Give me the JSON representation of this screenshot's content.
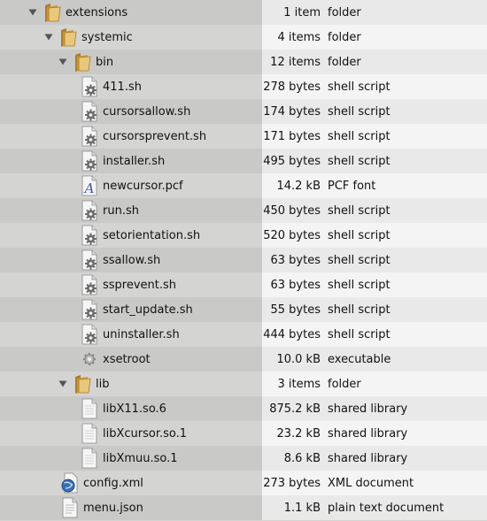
{
  "rows": [
    {
      "name": "extensions",
      "size": "1 item",
      "type": "folder",
      "depth": 0,
      "kind": "folder",
      "expanded": true
    },
    {
      "name": "systemic",
      "size": "4 items",
      "type": "folder",
      "depth": 1,
      "kind": "folder",
      "expanded": true
    },
    {
      "name": "bin",
      "size": "12 items",
      "type": "folder",
      "depth": 2,
      "kind": "folder",
      "expanded": true
    },
    {
      "name": "411.sh",
      "size": "278 bytes",
      "type": "shell script",
      "depth": 3,
      "kind": "script"
    },
    {
      "name": "cursorsallow.sh",
      "size": "174 bytes",
      "type": "shell script",
      "depth": 3,
      "kind": "script"
    },
    {
      "name": "cursorsprevent.sh",
      "size": "171 bytes",
      "type": "shell script",
      "depth": 3,
      "kind": "script"
    },
    {
      "name": "installer.sh",
      "size": "495 bytes",
      "type": "shell script",
      "depth": 3,
      "kind": "script"
    },
    {
      "name": "newcursor.pcf",
      "size": "14.2 kB",
      "type": "PCF font",
      "depth": 3,
      "kind": "font"
    },
    {
      "name": "run.sh",
      "size": "450 bytes",
      "type": "shell script",
      "depth": 3,
      "kind": "script"
    },
    {
      "name": "setorientation.sh",
      "size": "520 bytes",
      "type": "shell script",
      "depth": 3,
      "kind": "script"
    },
    {
      "name": "ssallow.sh",
      "size": "63 bytes",
      "type": "shell script",
      "depth": 3,
      "kind": "script"
    },
    {
      "name": "ssprevent.sh",
      "size": "63 bytes",
      "type": "shell script",
      "depth": 3,
      "kind": "script"
    },
    {
      "name": "start_update.sh",
      "size": "55 bytes",
      "type": "shell script",
      "depth": 3,
      "kind": "script"
    },
    {
      "name": "uninstaller.sh",
      "size": "444 bytes",
      "type": "shell script",
      "depth": 3,
      "kind": "script"
    },
    {
      "name": "xsetroot",
      "size": "10.0 kB",
      "type": "executable",
      "depth": 3,
      "kind": "executable"
    },
    {
      "name": "lib",
      "size": "3 items",
      "type": "folder",
      "depth": 2,
      "kind": "folder",
      "expanded": true
    },
    {
      "name": "libX11.so.6",
      "size": "875.2 kB",
      "type": "shared library",
      "depth": 3,
      "kind": "library"
    },
    {
      "name": "libXcursor.so.1",
      "size": "23.2 kB",
      "type": "shared library",
      "depth": 3,
      "kind": "library"
    },
    {
      "name": "libXmuu.so.1",
      "size": "8.6 kB",
      "type": "shared library",
      "depth": 3,
      "kind": "library"
    },
    {
      "name": "config.xml",
      "size": "273 bytes",
      "type": "XML document",
      "depth": 2,
      "kind": "xml"
    },
    {
      "name": "menu.json",
      "size": "1.1 kB",
      "type": "plain text document",
      "depth": 2,
      "kind": "text"
    }
  ],
  "icons": {
    "folder": "folder-icon",
    "script": "shell-script-icon",
    "font": "font-file-icon",
    "executable": "executable-gear-icon",
    "library": "shared-library-icon",
    "xml": "xml-document-icon",
    "text": "text-document-icon"
  },
  "colors": {
    "folder_body": "#c99a3b",
    "folder_front": "#e9c77c"
  }
}
